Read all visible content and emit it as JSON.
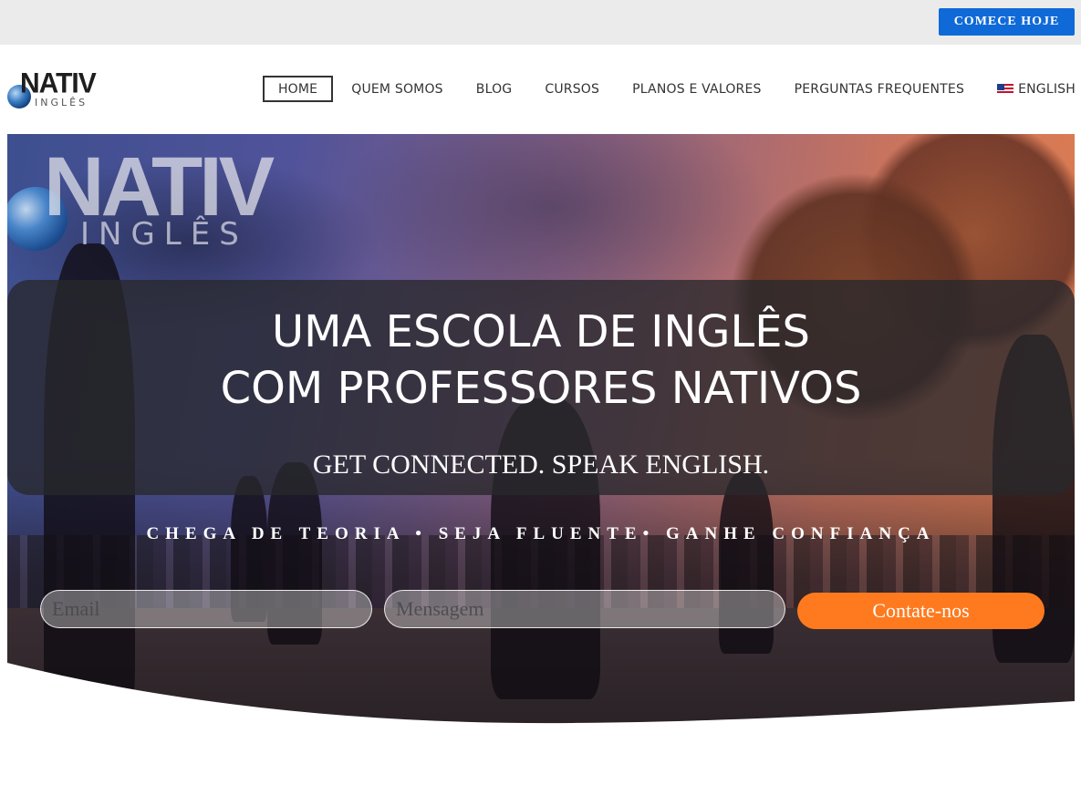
{
  "topbar": {
    "cta_label": "COMECE HOJE"
  },
  "header": {
    "logo": {
      "word": "NATIV",
      "sub": "INGLÊS"
    },
    "nav": {
      "home": "HOME",
      "about": "QUEM SOMOS",
      "blog": "BLOG",
      "courses": "CURSOS",
      "plans": "PLANOS E VALORES",
      "faq": "PERGUNTAS FREQUENTES",
      "language": "ENGLISH"
    }
  },
  "hero": {
    "logo": {
      "word": "NATIV",
      "sub": "INGLÊS"
    },
    "headline_line1": "UMA ESCOLA DE INGLÊS",
    "headline_line2": "COM PROFESSORES NATIVOS",
    "tagline": "GET CONNECTED. SPEAK ENGLISH.",
    "benefits": "CHEGA DE TEORIA • SEJA FLUENTE• GANHE CONFIANÇA"
  },
  "form": {
    "email_placeholder": "Email",
    "message_placeholder": "Mensagem",
    "submit_label": "Contate-nos"
  },
  "colors": {
    "topbar_bg": "#ebebeb",
    "cta_blue": "#0f6ad8",
    "accent_orange": "#ff7a1f"
  }
}
